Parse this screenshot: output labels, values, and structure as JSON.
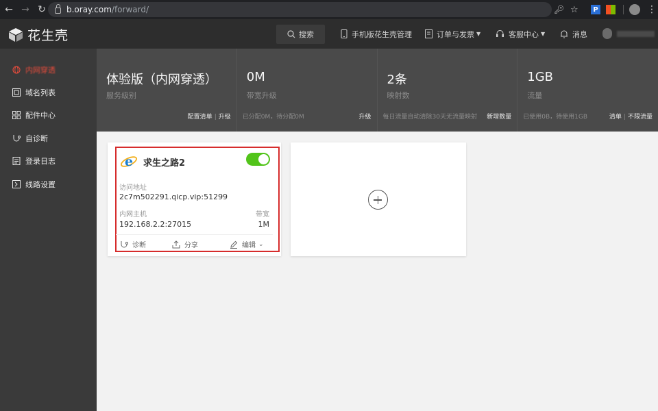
{
  "browser": {
    "url_host": "b.oray.com",
    "url_path": "/forward/",
    "ext_p_label": "P"
  },
  "app": {
    "logo_text": "花生壳",
    "search_label": "搜索",
    "menu": {
      "mobile": "手机版花生壳管理",
      "orders": "订单与发票",
      "service": "客服中心",
      "messages": "消息"
    }
  },
  "sidebar": {
    "items": [
      {
        "label": "内网穿透",
        "icon": "globe-icon",
        "active": true
      },
      {
        "label": "域名列表",
        "icon": "domain-list-icon"
      },
      {
        "label": "配件中心",
        "icon": "grid-icon"
      },
      {
        "label": "自诊断",
        "icon": "diagnose-icon"
      },
      {
        "label": "登录日志",
        "icon": "log-icon"
      },
      {
        "label": "线路设置",
        "icon": "route-icon"
      }
    ]
  },
  "stats": [
    {
      "value": "体验版（内网穿透）",
      "label": "服务级别",
      "foot_left": "",
      "foot_actions": [
        "配置清单",
        "升级"
      ]
    },
    {
      "value": "0M",
      "label": "带宽升级",
      "foot_left": "已分配0M，待分配0M",
      "foot_actions": [
        "升级"
      ]
    },
    {
      "value": "2条",
      "label": "映射数",
      "foot_left": "每日流量自动清除30天无流量映射",
      "foot_actions": [
        "新增数量"
      ]
    },
    {
      "value": "1GB",
      "label": "流量",
      "foot_left": "已使用0B，待使用1GB",
      "foot_actions": [
        "清单",
        "不限流量"
      ]
    }
  ],
  "mapping_card": {
    "title": "求生之路2",
    "enabled": true,
    "access_label": "访问地址",
    "access_value": "2c7m502291.qicp.vip:51299",
    "host_label": "内网主机",
    "host_value": "192.168.2.2:27015",
    "bandwidth_label": "带宽",
    "bandwidth_value": "1M",
    "actions": {
      "diagnose": "诊断",
      "share": "分享",
      "edit": "编辑"
    }
  },
  "colors": {
    "accent_red": "#d62c2c",
    "toggle_green": "#52c41a",
    "sidebar_bg": "#3a3a3a",
    "header_bg": "#2d2d2d"
  }
}
